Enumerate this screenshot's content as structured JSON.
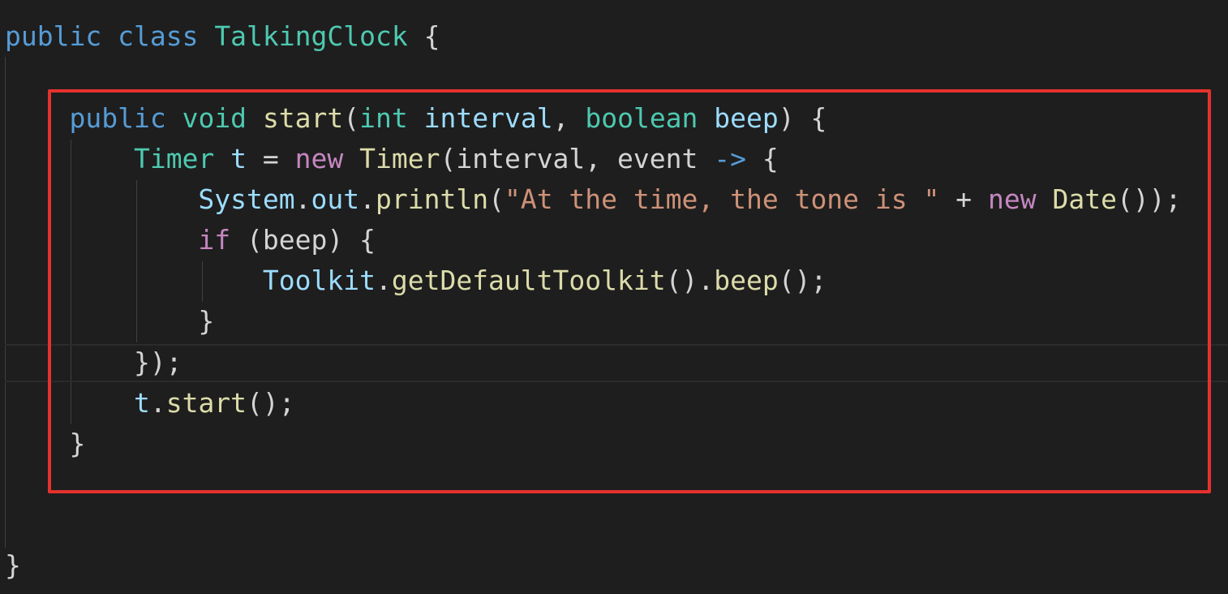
{
  "editor": {
    "colors": {
      "background": "#1e1e1e",
      "keyword": "#569cd6",
      "type": "#4ec9b0",
      "function": "#dcdcaa",
      "variable": "#9cdcfe",
      "string": "#ce9178",
      "control": "#c586c0",
      "punctuation": "#d4d4d4",
      "highlight_border": "#e5322d"
    },
    "lines": [
      [
        {
          "t": "public",
          "k": "kw"
        },
        {
          "t": " ",
          "k": "punc"
        },
        {
          "t": "class",
          "k": "kw"
        },
        {
          "t": " ",
          "k": "punc"
        },
        {
          "t": "TalkingClock",
          "k": "type"
        },
        {
          "t": " {",
          "k": "punc"
        }
      ],
      [],
      [
        {
          "t": "    ",
          "k": "punc"
        },
        {
          "t": "public",
          "k": "kw"
        },
        {
          "t": " ",
          "k": "punc"
        },
        {
          "t": "void",
          "k": "type"
        },
        {
          "t": " ",
          "k": "punc"
        },
        {
          "t": "start",
          "k": "fn"
        },
        {
          "t": "(",
          "k": "punc"
        },
        {
          "t": "int",
          "k": "type"
        },
        {
          "t": " ",
          "k": "punc"
        },
        {
          "t": "interval",
          "k": "var"
        },
        {
          "t": ", ",
          "k": "punc"
        },
        {
          "t": "boolean",
          "k": "type"
        },
        {
          "t": " ",
          "k": "punc"
        },
        {
          "t": "beep",
          "k": "var"
        },
        {
          "t": ") {",
          "k": "punc"
        }
      ],
      [
        {
          "t": "        ",
          "k": "punc"
        },
        {
          "t": "Timer",
          "k": "type"
        },
        {
          "t": " ",
          "k": "punc"
        },
        {
          "t": "t",
          "k": "var"
        },
        {
          "t": " = ",
          "k": "punc"
        },
        {
          "t": "new",
          "k": "ctrl"
        },
        {
          "t": " ",
          "k": "punc"
        },
        {
          "t": "Timer",
          "k": "fn"
        },
        {
          "t": "(interval, event ",
          "k": "punc"
        },
        {
          "t": "->",
          "k": "kw"
        },
        {
          "t": " {",
          "k": "punc"
        }
      ],
      [
        {
          "t": "            ",
          "k": "punc"
        },
        {
          "t": "System",
          "k": "var"
        },
        {
          "t": ".",
          "k": "punc"
        },
        {
          "t": "out",
          "k": "var"
        },
        {
          "t": ".",
          "k": "punc"
        },
        {
          "t": "println",
          "k": "fn"
        },
        {
          "t": "(",
          "k": "punc"
        },
        {
          "t": "\"At the time, the tone is \"",
          "k": "str"
        },
        {
          "t": " + ",
          "k": "punc"
        },
        {
          "t": "new",
          "k": "ctrl"
        },
        {
          "t": " ",
          "k": "punc"
        },
        {
          "t": "Date",
          "k": "fn"
        },
        {
          "t": "());",
          "k": "punc"
        }
      ],
      [
        {
          "t": "            ",
          "k": "punc"
        },
        {
          "t": "if",
          "k": "ctrl"
        },
        {
          "t": " (beep) {",
          "k": "punc"
        }
      ],
      [
        {
          "t": "                ",
          "k": "punc"
        },
        {
          "t": "Toolkit",
          "k": "var"
        },
        {
          "t": ".",
          "k": "punc"
        },
        {
          "t": "getDefaultToolkit",
          "k": "fn"
        },
        {
          "t": "().",
          "k": "punc"
        },
        {
          "t": "beep",
          "k": "fn"
        },
        {
          "t": "();",
          "k": "punc"
        }
      ],
      [
        {
          "t": "            }",
          "k": "punc"
        }
      ],
      [
        {
          "t": "        });",
          "k": "punc"
        }
      ],
      [
        {
          "t": "        ",
          "k": "punc"
        },
        {
          "t": "t",
          "k": "var"
        },
        {
          "t": ".",
          "k": "punc"
        },
        {
          "t": "start",
          "k": "fn"
        },
        {
          "t": "();",
          "k": "punc"
        }
      ],
      [
        {
          "t": "    }",
          "k": "punc"
        }
      ],
      [],
      [],
      [
        {
          "t": "}",
          "k": "punc"
        }
      ]
    ]
  }
}
